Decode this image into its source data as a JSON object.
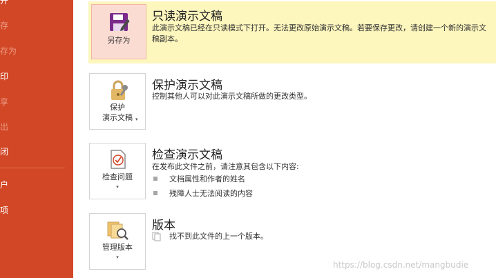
{
  "sidebar": {
    "items": [
      {
        "label": "开",
        "dim": false
      },
      {
        "label": "存",
        "dim": true
      },
      {
        "label": "存为",
        "dim": true
      },
      {
        "label": "印",
        "dim": false
      },
      {
        "label": "享",
        "dim": true
      },
      {
        "label": "出",
        "dim": true
      },
      {
        "label": "闭",
        "dim": false
      },
      {
        "label": "户",
        "dim": false
      },
      {
        "label": "项",
        "dim": false
      }
    ]
  },
  "readonly": {
    "button_label": "另存为",
    "title": "只读演示文稿",
    "description": "此演示文稿已经在只读模式下打开。无法更改原始演示文稿。若要保存更改，请创建一个新的演示文稿副本。"
  },
  "protect": {
    "button_line1": "保护",
    "button_line2": "演示文稿",
    "title": "保护演示文稿",
    "description": "控制其他人可以对此演示文稿所做的更改类型。"
  },
  "inspect": {
    "button_label": "检查问题",
    "title": "检查演示文稿",
    "description": "在发布此文件之前，请注意其包含以下内容:",
    "bullets": [
      "文档属性和作者的姓名",
      "残障人士无法阅读的内容"
    ]
  },
  "versions": {
    "button_label": "管理版本",
    "title": "版本",
    "description": "找不到此文件的上一个版本。"
  },
  "watermark": "https://blog.csdn.net/mangbudie",
  "colors": {
    "sidebar": "#d24726",
    "notice": "#fdf6bd",
    "accent": "#7b2a8c"
  }
}
